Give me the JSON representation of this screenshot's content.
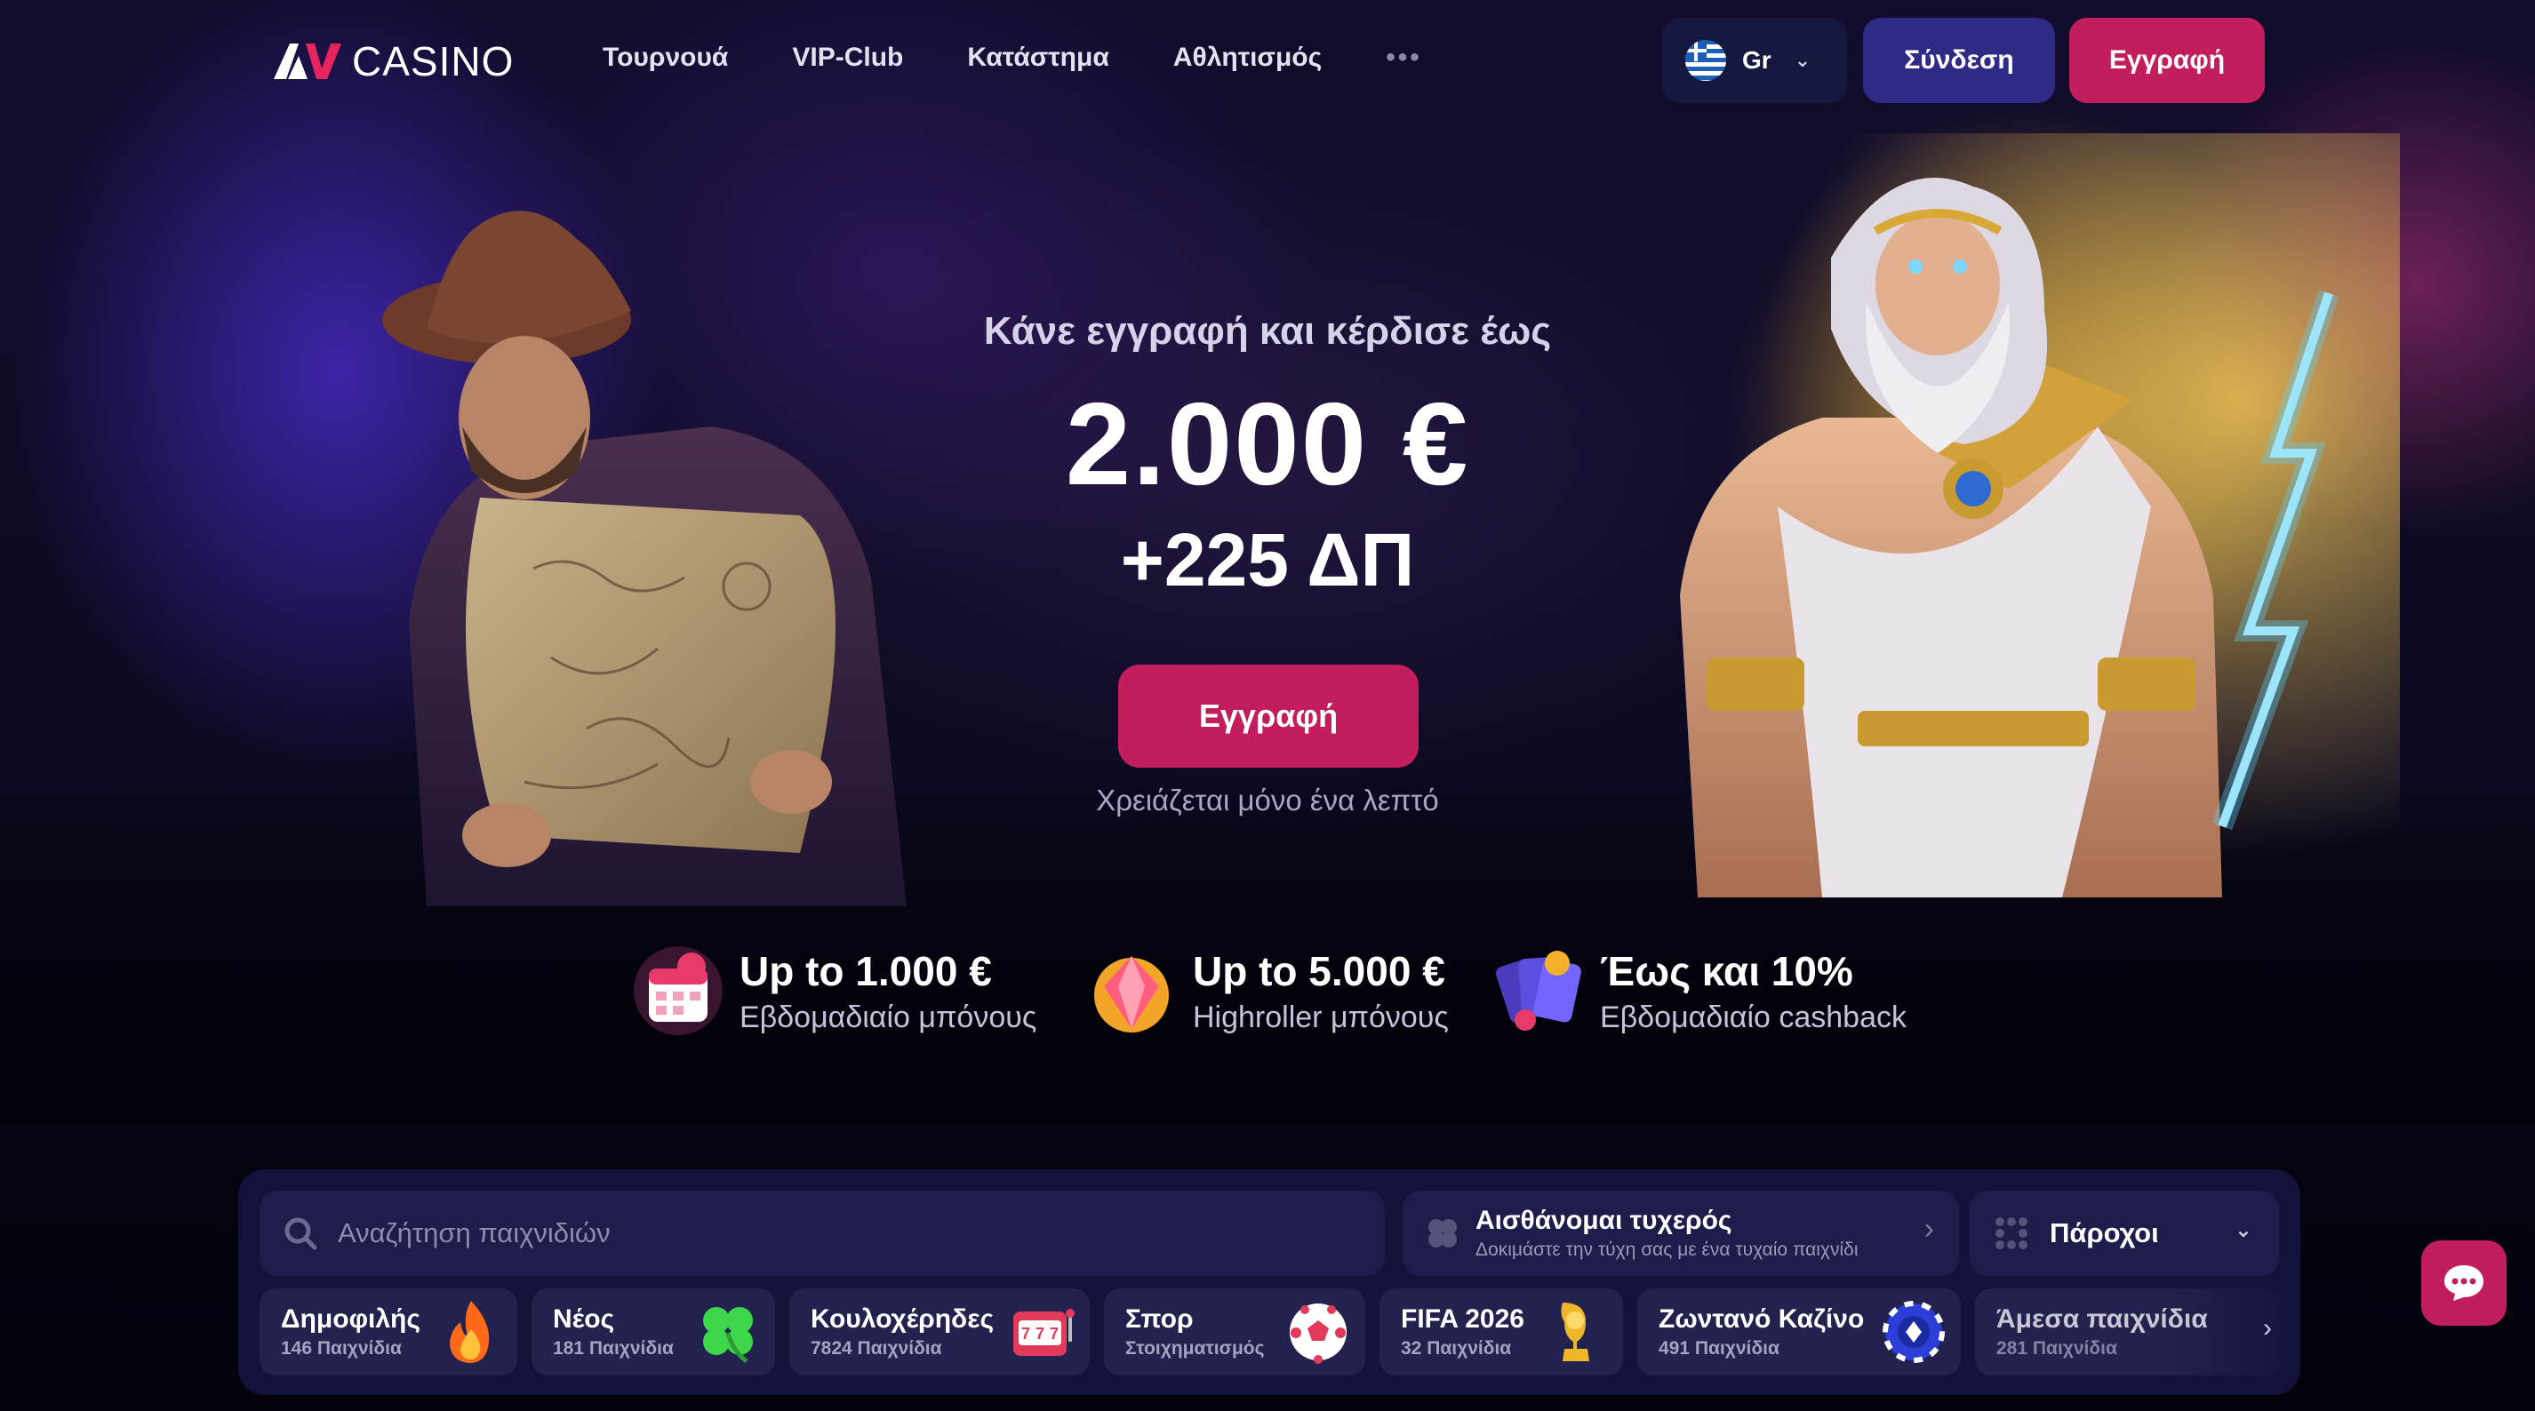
{
  "brand": {
    "logo_text": "CASINO"
  },
  "nav": {
    "items": [
      "Τουρνουά",
      "VIP-Club",
      "Κατάστημα",
      "Αθλητισμός"
    ],
    "more": "•••"
  },
  "language": {
    "code": "Gr"
  },
  "header": {
    "login": "Σύνδεση",
    "register": "Εγγραφή"
  },
  "hero": {
    "subtitle": "Κάνε εγγραφή και κέρδισε έως",
    "amount": "2.000 €",
    "extra": "+225 ΔΠ",
    "cta": "Εγγραφή",
    "note": "Χρειάζεται μόνο ένα λεπτό"
  },
  "promos": [
    {
      "title": "Up to 1.000 €",
      "subtitle": "Εβδομαδιαίο μπόνους",
      "icon": "calendar-icon"
    },
    {
      "title": "Up to 5.000 €",
      "subtitle": "Highroller μπόνους",
      "icon": "gem-icon"
    },
    {
      "title": "Έως και 10%",
      "subtitle": "Εβδομαδιαίο cashback",
      "icon": "cards-icon"
    }
  ],
  "games": {
    "search_placeholder": "Αναζήτηση παιχνιδιών",
    "lucky_title": "Αισθάνομαι τυχερός",
    "lucky_sub": "Δοκιμάστε την τύχη σας με ένα τυχαίο παιχνίδι",
    "providers": "Πάροχοι",
    "categories": [
      {
        "name": "Δημοφιλής",
        "count": "146 Παιχνίδια",
        "icon": "fire-icon"
      },
      {
        "name": "Νέος",
        "count": "181 Παιχνίδια",
        "icon": "clover-icon"
      },
      {
        "name": "Κουλοχέρηδες",
        "count": "7824 Παιχνίδια",
        "icon": "slot-machine-icon"
      },
      {
        "name": "Σπορ",
        "count": "Στοιχηματισμός",
        "icon": "soccer-ball-icon"
      },
      {
        "name": "FIFA 2026",
        "count": "32 Παιχνίδια",
        "icon": "trophy-icon"
      },
      {
        "name": "Ζωντανό Καζίνο",
        "count": "491 Παιχνίδια",
        "icon": "chip-icon"
      },
      {
        "name": "Άμεσα παιχνίδια",
        "count": "281 Παιχνίδια",
        "icon": "instant-icon"
      }
    ]
  },
  "colors": {
    "accent": "#c21d5c",
    "login": "#2f2a86",
    "panel": "#13123a"
  }
}
